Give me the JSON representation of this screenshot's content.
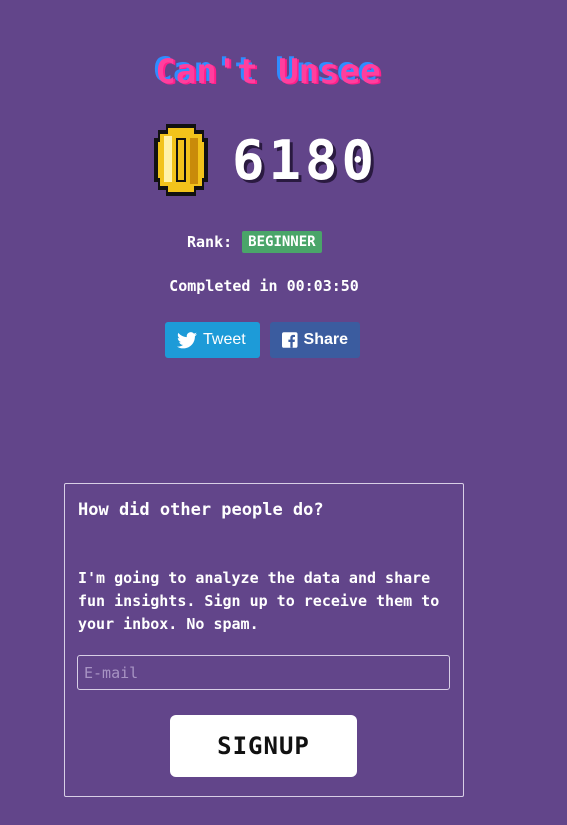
{
  "header": {
    "title": "Can't Unsee"
  },
  "score": {
    "value": "6180",
    "icon": "coin-icon"
  },
  "rank": {
    "label": "Rank:",
    "value": "BEGINNER",
    "color": "#4aa569"
  },
  "completed": {
    "text": "Completed in 00:03:50"
  },
  "social": {
    "tweet_label": "Tweet",
    "share_label": "Share"
  },
  "signup_card": {
    "heading": "How did other people do?",
    "body": "I'm going to analyze the data and share fun insights. Sign up to receive them to your inbox. No spam.",
    "email_placeholder": "E-mail",
    "email_value": "",
    "button_label": "SIGNUP"
  },
  "colors": {
    "background": "#62458a",
    "tweet": "#1d9bd8",
    "share": "#3b5c9f"
  }
}
